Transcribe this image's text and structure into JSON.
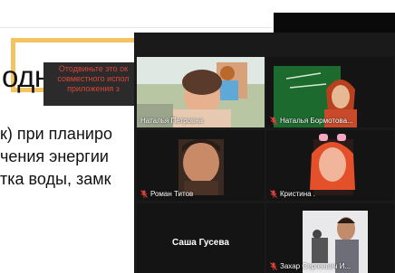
{
  "slide": {
    "title": "одного д",
    "lines": [
      "к) при планиро",
      "чения энергии",
      "тка воды, замк"
    ],
    "banner": "Отодвиньте это ок\nсовместного испол\nприложения з"
  },
  "participants": [
    {
      "name": "Наталья Петровна",
      "active": true,
      "muted": false
    },
    {
      "name": "Наталья Бормотова...",
      "active": false,
      "muted": true
    },
    {
      "name": "Роман Титов",
      "active": false,
      "muted": true
    },
    {
      "name": "Кристина .",
      "active": false,
      "muted": true
    },
    {
      "name": "Саша Гусева",
      "active": false,
      "muted": false,
      "video_off": true
    },
    {
      "name": "Захар Сергеевич И...",
      "active": false,
      "muted": true
    }
  ],
  "colors": {
    "active_border": "#c7e34a",
    "muted_icon": "#e0413a",
    "slide_frame": "#f4c463"
  },
  "icons": {
    "muted": "mic-muted-icon"
  }
}
